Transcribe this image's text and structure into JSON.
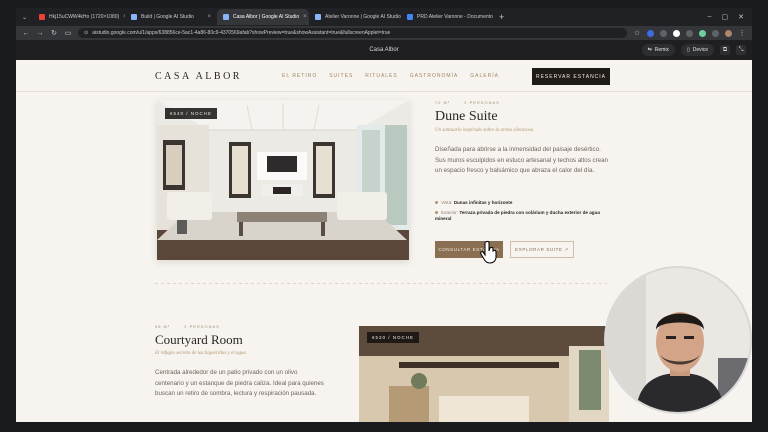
{
  "browser": {
    "tabs": [
      {
        "label": "Hkj15uCWW4kHo (1720×1080)",
        "active": false
      },
      {
        "label": "Build | Google AI Studio",
        "active": false
      },
      {
        "label": "Casa Albor | Google AI Studio",
        "active": true
      },
      {
        "label": "Atelier Varonne | Google AI Studio",
        "active": false
      },
      {
        "label": "PRD Atelier Varonne - Documento",
        "active": false
      }
    ],
    "url": "aistudio.google.com/u/1/apps/638856ce-5ac1-4a86-80c9-4370569afab?showPreview=true&showAssistant=true&fullscreenApplet=true"
  },
  "app": {
    "title": "Casa Albor",
    "remix_label": "Remix",
    "device_label": "Device"
  },
  "site": {
    "logo": "CASA ALBOR",
    "nav": [
      "EL RETIRO",
      "SUITES",
      "RITUALES",
      "GASTRONOMÍA",
      "GALERÍA"
    ],
    "cta": "RESERVAR ESTANCIA"
  },
  "dune": {
    "price": "€640 / NOCHE",
    "size": "72 M²",
    "guests": "2 PERSONAS",
    "title": "Dune Suite",
    "subtitle": "Un santuario inspirado sobre la arena silenciosa",
    "description": "Diseñada para abrirse a la inmensidad del paisaje desértico. Sus muros esculpidos en estuco artesanal y techos altos crean un espacio fresco y balsámico que abraza el calor del día.",
    "features": [
      {
        "label": "Vista:",
        "value": "Dunas infinitas y horizonte"
      },
      {
        "label": "Exterior:",
        "value": "Terraza privada de piedra con solárium y ducha exterior de agua mineral"
      }
    ],
    "primary_button": "CONSULTAR ESTANCIA",
    "secondary_button": "EXPLORAR SUITE ↗"
  },
  "courtyard": {
    "price": "€520 / NOCHE",
    "size": "58 M²",
    "guests": "2 PERSONAS",
    "title": "Courtyard Room",
    "subtitle": "El refugio secreto de las higuerillas y el agua",
    "description": "Centrada alrededor de un patio privado con un olivo centenario y un estanque de piedra caliza. Ideal para quienes buscan un retiro de sombra, lectura y respiración pausada."
  }
}
